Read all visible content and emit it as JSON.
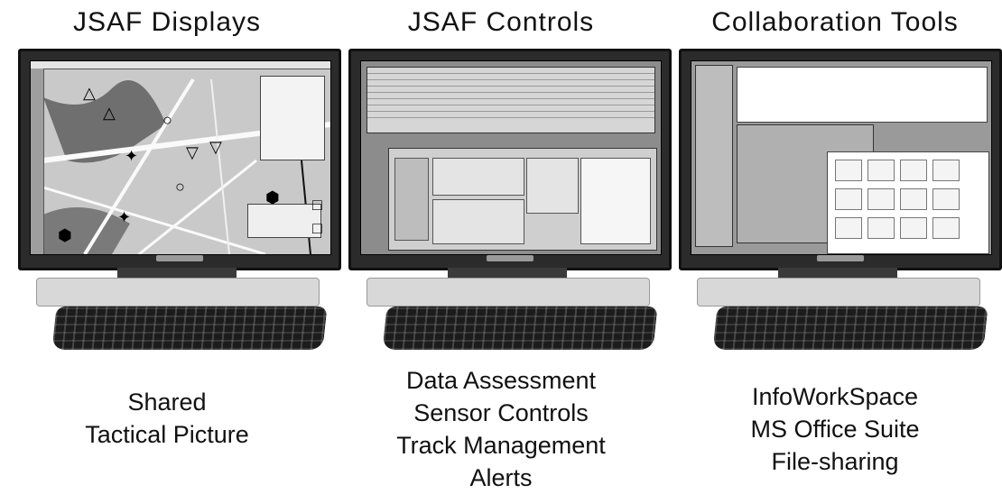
{
  "columns": [
    {
      "title": "JSAF Displays",
      "caption": [
        "Shared",
        "Tactical Picture"
      ]
    },
    {
      "title": "JSAF Controls",
      "caption": [
        "Data Assessment",
        "Sensor Controls",
        "Track Management",
        "Alerts"
      ]
    },
    {
      "title": "Collaboration Tools",
      "caption": [
        "InfoWorkSpace",
        "MS Office Suite",
        "File-sharing"
      ]
    }
  ],
  "colors": {
    "bezel": "#2b2b2b",
    "background": "#ffffff",
    "text": "#111111"
  }
}
